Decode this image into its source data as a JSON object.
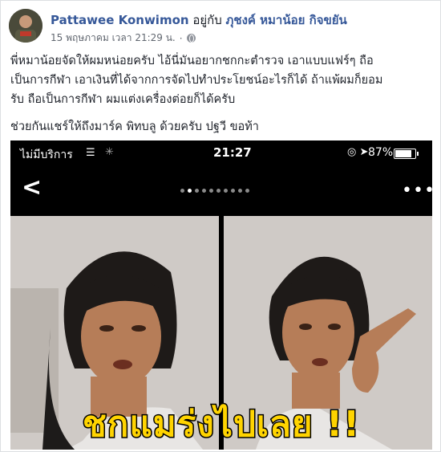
{
  "post": {
    "author_name": "Pattawee Konwimon",
    "with_text": " อยู่กับ ",
    "tagged_people": "ภุชงค์ หมาน้อย กิจขยัน",
    "date": "15 พฤษภาคม เวลา 21:29 น.",
    "separator": "·",
    "body_lines": [
      "พี่หมาน้อยจัดให้ผมหน่อยครับ ไอ้นี่มันอยากชกกะตำรวจ เอาแบบแฟร์ๆ ถือ",
      "เป็นการกีฬา เอาเงินที่ได้จากการจัดไปทำประโยชน์อะไรก็ได้ ถ้าแพ้ผมก็ยอม",
      "รับ ถือเป็นการกีฬา ผมแต่งเครื่องต่อยก็ได้ครับ"
    ],
    "share_line": "ช่วยกันแชร์ให้ถึงมาร์ค พิทบลู ด้วยครับ ปฐวี ขอท้า"
  },
  "screenshot": {
    "carrier": "ไม่มีบริการ",
    "time": "21:27",
    "battery": "87%",
    "back_glyph": "<",
    "more_glyph": "•••",
    "caption": "ชกแมร่งไปเลย !!"
  },
  "colors": {
    "link": "#365899",
    "caption_yellow": "#ffd400"
  },
  "icons": [
    "globe-icon",
    "wifi-icon",
    "location-icon",
    "battery-icon",
    "back-icon",
    "more-icon"
  ]
}
